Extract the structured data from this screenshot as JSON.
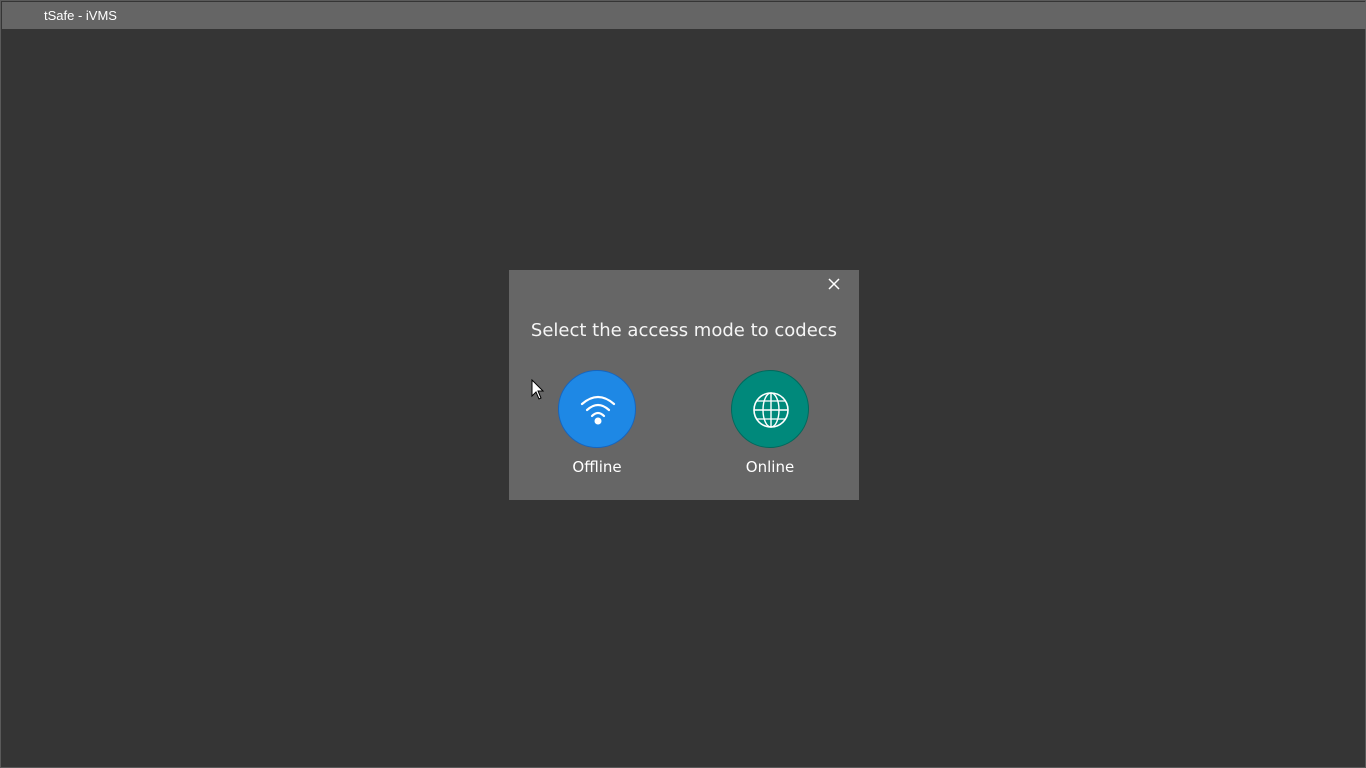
{
  "window": {
    "title": "tSafe - iVMS"
  },
  "dialog": {
    "heading": "Select the access mode to codecs",
    "close_icon": "close-icon",
    "options": [
      {
        "label": "Offline",
        "icon": "wifi-icon",
        "color": "#1e88e5"
      },
      {
        "label": "Online",
        "icon": "globe-icon",
        "color": "#00897b"
      }
    ]
  },
  "colors": {
    "background": "#353535",
    "titlebar": "#656565",
    "dialog": "#666666"
  }
}
